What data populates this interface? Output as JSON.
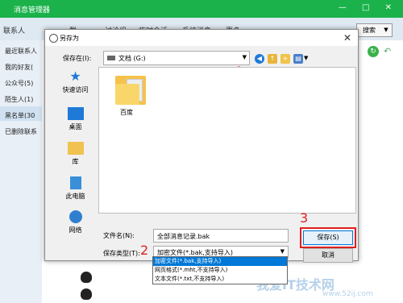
{
  "main_window": {
    "title": "消息管理器",
    "window_buttons": "— □ ✕",
    "tabs": [
      "联系人",
      "群",
      "讨论组",
      "临时会话",
      "系统消息",
      "更多"
    ],
    "search_label": "搜索",
    "sidebar": [
      "最近联系人",
      "我的好友(",
      "公众号(5)",
      "陌生人(1)",
      "黑名单(30",
      "已删除联系"
    ]
  },
  "dialog": {
    "title": "另存为",
    "save_in_label": "保存在(I):",
    "save_in_value": "文档 (G:)",
    "places": [
      "快速访问",
      "桌面",
      "库",
      "此电脑",
      "网络"
    ],
    "files": [
      {
        "name": "百度"
      }
    ],
    "filename_label": "文件名(N):",
    "filename_value": "全部消息记录.bak",
    "filetype_label": "保存类型(T):",
    "filetype_value": "加密文件(*.bak,支持导入)",
    "filetype_options": [
      "加密文件(*.bak,支持导入)",
      "网页格式(*.mht,不支持导入)",
      "文本文件(*.txt,不支持导入)"
    ],
    "save_button": "保存(S)",
    "cancel_button": "取消"
  },
  "annotations": {
    "n1": "1",
    "n2": "2",
    "n3": "3"
  },
  "watermark": {
    "text": "我爱IT技术网",
    "sub": "www.52ij.com"
  },
  "colors": {
    "accent": "#1bb24b",
    "highlight": "#e02020",
    "select": "#0078d7"
  }
}
